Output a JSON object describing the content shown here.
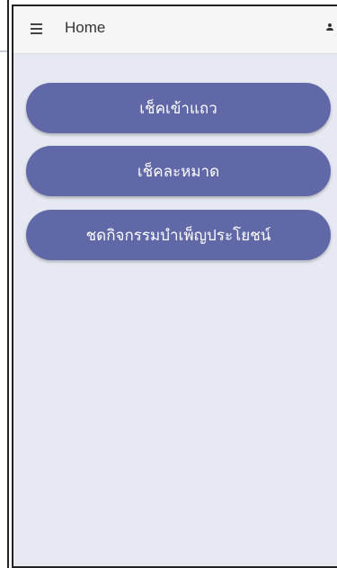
{
  "app_bar": {
    "title": "Home",
    "menu_icon": "hamburger-menu-icon",
    "user_icon": "user-icon"
  },
  "actions": [
    {
      "label": "เช็คเข้าแถว"
    },
    {
      "label": "เช็คละหมาด"
    },
    {
      "label": "ชดกิจกรรมบำเพ็ญประโยชน์"
    }
  ],
  "colors": {
    "button_bg": "#6068a8",
    "button_text": "#ffffff",
    "page_bg": "#e6e9f1",
    "app_bar_bg": "#f6f6f6"
  }
}
